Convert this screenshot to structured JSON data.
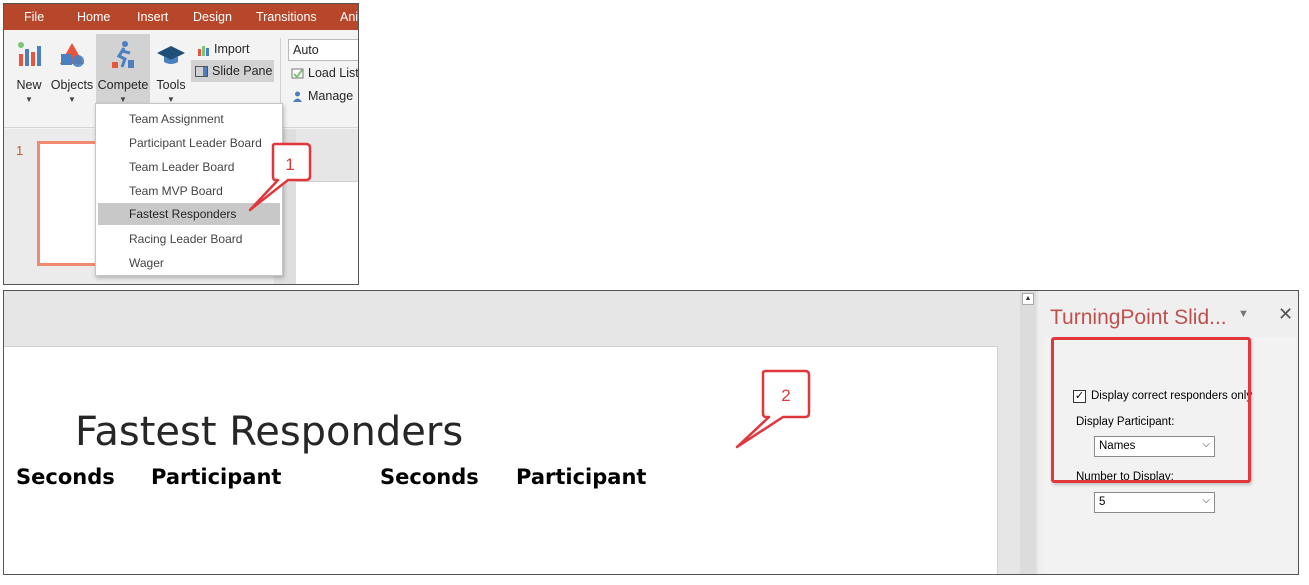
{
  "top": {
    "tabs": [
      "File",
      "Home",
      "Insert",
      "Design",
      "Transitions",
      "Ani"
    ],
    "ribbon": {
      "new_label": "New",
      "objects_label": "Objects",
      "compete_label": "Compete",
      "tools_label": "Tools",
      "import_label": "Import",
      "slide_pane_label": "Slide Pane",
      "auto_value": "Auto",
      "load_list_label": "Load List",
      "manage_label": "Manage"
    },
    "slide_number": "1",
    "compete_menu": [
      "Team Assignment",
      "Participant Leader Board",
      "Team Leader Board",
      "Team MVP Board",
      "Fastest Responders",
      "Racing Leader Board",
      "Wager"
    ],
    "highlighted_item": "Fastest Responders",
    "callout_label": "1"
  },
  "bottom": {
    "slide": {
      "title": "Fastest Responders",
      "columns": [
        "Seconds",
        "Participant",
        "Seconds",
        "Participant"
      ]
    },
    "task_pane": {
      "title": "TurningPoint Slid...",
      "checkbox_label": "Display correct responders only",
      "checkbox_checked": true,
      "participant_label": "Display Participant:",
      "participant_value": "Names",
      "number_label": "Number to Display:",
      "number_value": "5"
    },
    "callout_label": "2"
  },
  "colors": {
    "tab_bar": "#b7472a",
    "annotation_red": "#e0363c",
    "pane_title": "#c0504d"
  }
}
